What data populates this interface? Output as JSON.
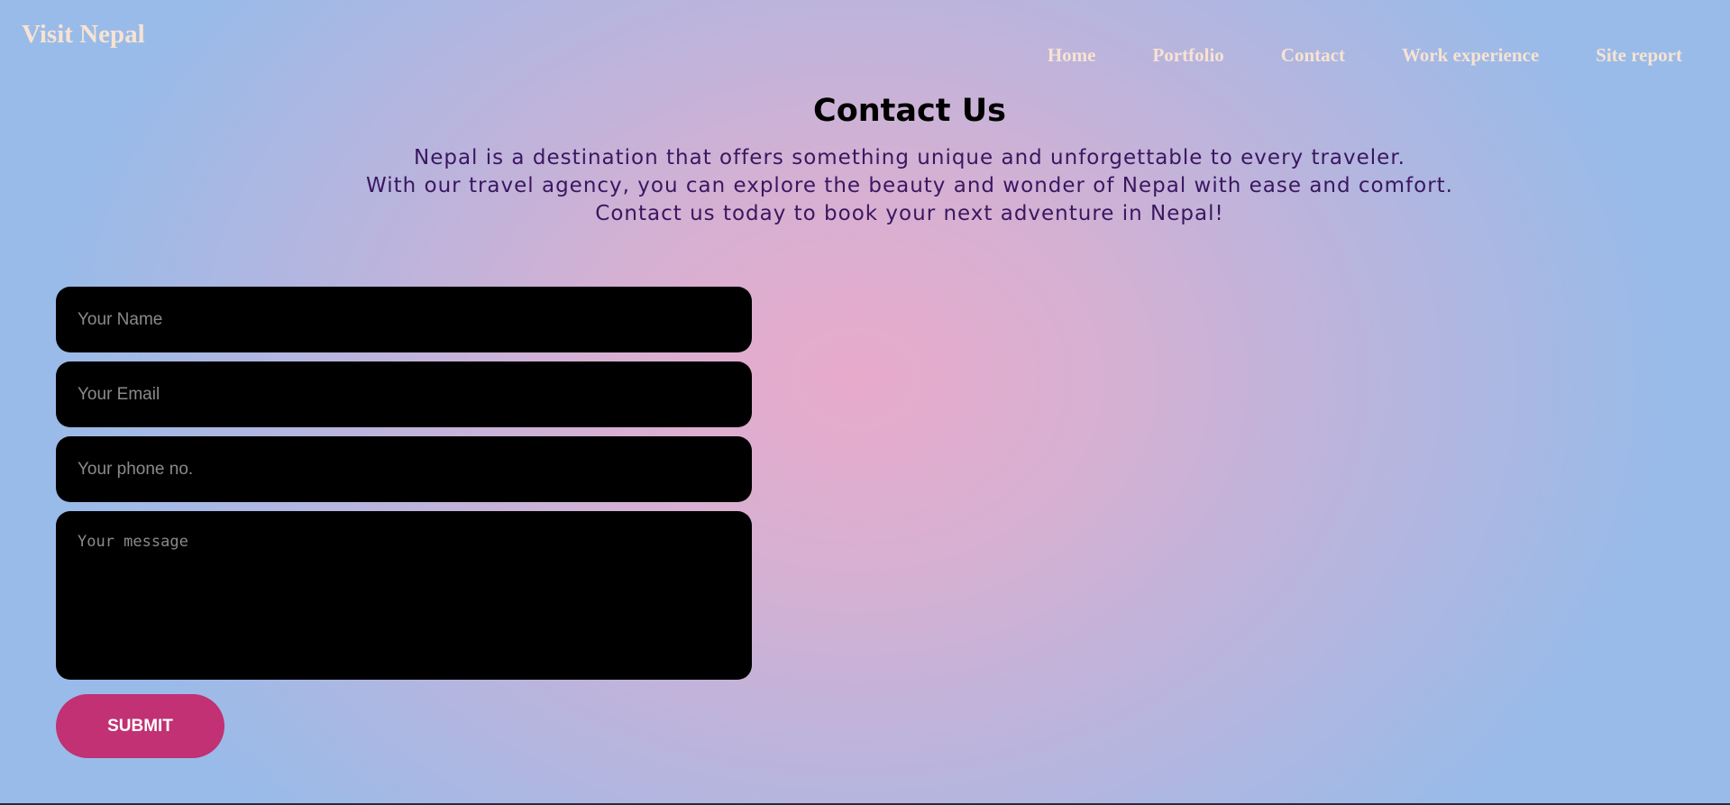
{
  "header": {
    "brand": "Visit Nepal",
    "nav": [
      {
        "label": "Home"
      },
      {
        "label": "Portfolio"
      },
      {
        "label": "Contact"
      },
      {
        "label": "Work experience"
      },
      {
        "label": "Site report"
      }
    ]
  },
  "main": {
    "title": "Contact Us",
    "intro_lines": [
      "Nepal is a destination that offers something unique and unforgettable to every traveler.",
      "With our travel agency, you can explore the beauty and wonder of Nepal with ease and comfort.",
      "Contact us today to book your next adventure in Nepal!"
    ]
  },
  "form": {
    "name_placeholder": "Your Name",
    "email_placeholder": "Your Email",
    "phone_placeholder": "Your phone no.",
    "message_placeholder": "Your message",
    "submit_label": "SUBMIT"
  },
  "colors": {
    "brand_text": "#f7e3d2",
    "heading": "#000000",
    "intro_text": "#3a1760",
    "field_bg": "#000000",
    "submit_bg": "#c13173"
  }
}
